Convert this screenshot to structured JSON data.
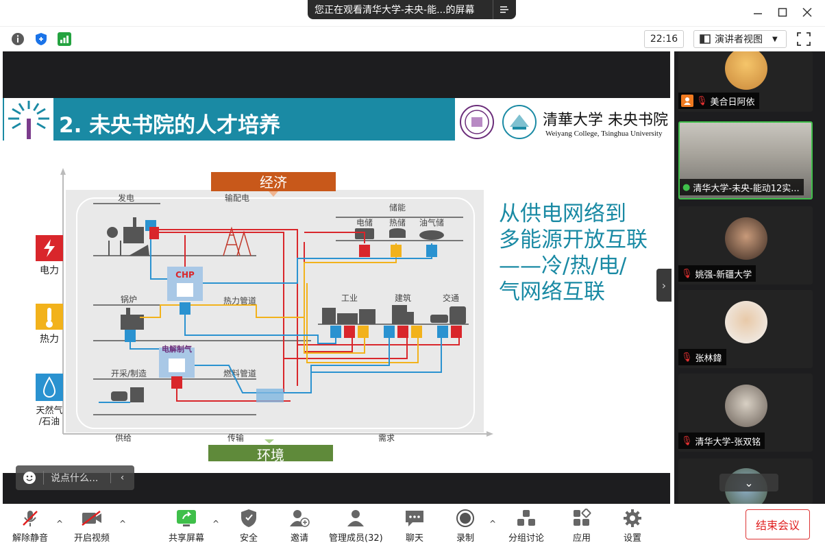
{
  "window": {
    "share_banner": "您正在观看清华大学-未央-能...的屏幕",
    "controls": [
      "minimize-icon",
      "maximize-icon",
      "close-icon"
    ]
  },
  "infobar": {
    "clock": "22:16",
    "view_mode": "演讲者视图"
  },
  "slide": {
    "title": "2.  未央书院的人才培养",
    "brand_cn": "清華大学 未央书院",
    "brand_en": "Weiyang College, Tsinghua University",
    "headline_lines": [
      "从供电网络到",
      "多能源开放互联",
      "——冷/热/电/",
      "气网络互联"
    ],
    "diagram": {
      "top_box": "经济",
      "bottom_box": "环境",
      "left_legend": [
        "电力",
        "热力",
        "天然气",
        "/石油"
      ],
      "columns": [
        "供给",
        "传输",
        "需求"
      ],
      "supply_sections": [
        "发电",
        "锅炉",
        "开采/制造"
      ],
      "transmission": [
        "输配电",
        "热力管道",
        "燃料管道"
      ],
      "storage_title": "储能",
      "storage_items": [
        "电储",
        "热储",
        "油气储"
      ],
      "demand_items": [
        "工业",
        "建筑",
        "交通"
      ],
      "chp": "CHP",
      "electrolysis": "电解制气"
    }
  },
  "chat": {
    "placeholder": "说点什么..."
  },
  "participants": [
    {
      "name": "美合日阿依",
      "mic": "person-icon"
    },
    {
      "name": "清华大学-未央-能动12实...",
      "mic": "mic-on-icon"
    },
    {
      "name": "姚强-新疆大学",
      "mic": "mic-muted-icon"
    },
    {
      "name": "张林鍏",
      "mic": "mic-muted-icon"
    },
    {
      "name": "清华大学-张双铭",
      "mic": "mic-muted-icon"
    }
  ],
  "toolbar": {
    "mute": "解除静音",
    "video": "开启视频",
    "share": "共享屏幕",
    "security": "安全",
    "invite": "邀请",
    "members": "管理成员(32)",
    "chat": "聊天",
    "record": "录制",
    "breakout": "分组讨论",
    "apps": "应用",
    "settings": "设置",
    "end": "结束会议"
  },
  "colors": {
    "accent_teal": "#1a8aa4",
    "power_red": "#d9262b",
    "heat_yellow": "#f2b21b",
    "gas_blue": "#2a92d0",
    "end_red": "#e02020",
    "active_green": "#3fbf4a"
  }
}
